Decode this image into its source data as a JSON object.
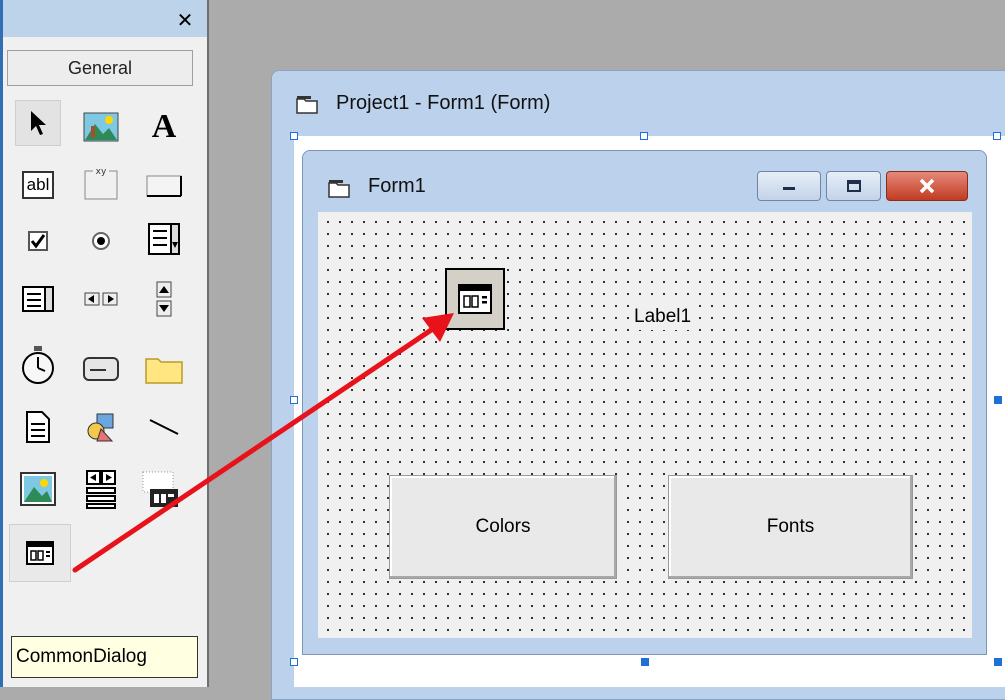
{
  "toolbox": {
    "close_glyph": "✕",
    "tab_label": "General",
    "label_tool_glyph": "A",
    "textbox_tool_glyph": "abl",
    "frame_tool_caption": "xy",
    "tools": [
      "pointer-icon",
      "picturebox-icon",
      "label-icon",
      "textbox-icon",
      "frame-icon",
      "commandbutton-icon",
      "checkbox-icon",
      "optionbutton-icon",
      "combobox-icon",
      "listbox-icon",
      "hscrollbar-icon",
      "vscrollbar-icon",
      "timer-icon",
      "drivelistbox-icon",
      "dirlistbox-icon",
      "filelistbox-icon",
      "shape-icon",
      "line-icon",
      "image-icon",
      "data-icon",
      "ole-icon",
      "commondialog-icon"
    ],
    "tooltip": "CommonDialog"
  },
  "project_window": {
    "title": "Project1 - Form1 (Form)"
  },
  "form": {
    "title": "Form1",
    "label_caption": "Label1",
    "colors_button": "Colors",
    "fonts_button": "Fonts"
  },
  "colors": {
    "selection_handle": "#1f6fd6",
    "arrow": "#e8121b",
    "window_frame": "#bcd2ec",
    "close_button": "#c23b22"
  }
}
